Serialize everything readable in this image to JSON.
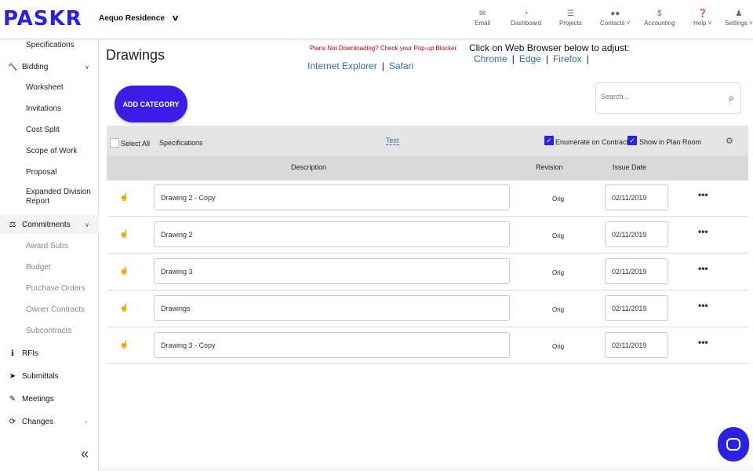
{
  "app": {
    "logo": "PASKR",
    "project": "Aequo Residence"
  },
  "nav": [
    {
      "label": "Email",
      "icon": "email-icon",
      "glyph": "✉"
    },
    {
      "label": "Dashboard",
      "icon": "dashboard-icon",
      "glyph": "◔"
    },
    {
      "label": "Projects",
      "icon": "projects-icon",
      "glyph": "☰"
    },
    {
      "label": "Contacts",
      "icon": "contacts-icon",
      "glyph": "👥"
    },
    {
      "label": "Accounting",
      "icon": "accounting-icon",
      "glyph": "$"
    },
    {
      "label": "Help",
      "icon": "help-icon",
      "glyph": "?"
    },
    {
      "label": "Settings",
      "icon": "settings-icon",
      "glyph": "👤"
    }
  ],
  "sidebar": {
    "top_partial": "Specifications",
    "bidding": {
      "label": "Bidding",
      "items": [
        "Worksheet",
        "Invitations",
        "Cost Split",
        "Scope of Work",
        "Proposal",
        "Expanded Division Report"
      ]
    },
    "commitments": {
      "label": "Commitments",
      "items": [
        "Award Subs",
        "Budget",
        "Purchase Orders",
        "Owner Contracts",
        "Subcontracts"
      ]
    },
    "rfis": "RFIs",
    "submittals": "Submittals",
    "meetings": "Meetings",
    "changes": "Changes"
  },
  "page": {
    "title": "Drawings",
    "notice": "Plans Not Downloading? Check your Pop-up Blocker.",
    "browser_prompt": "Click on Web Browser below to adjust:",
    "browsers": [
      "Chrome",
      "Edge",
      "Firefox",
      "Internet Explorer",
      "Safari"
    ]
  },
  "toolbar": {
    "add_category": "ADD CATEGORY",
    "search_placeholder": "Search...",
    "select_all": "Select All",
    "category": "Specifications",
    "test_link": "Test",
    "enumerate": "Enumerate on Contracts",
    "plan_room": "Show in Plan Room"
  },
  "table": {
    "headers": {
      "description": "Description",
      "revision": "Revision",
      "issue_date": "Issue Date"
    },
    "rows": [
      {
        "description": "Drawing 2 - Copy",
        "revision": "Orig",
        "date": "02/11/2019"
      },
      {
        "description": "Drawing 2",
        "revision": "Orig",
        "date": "02/11/2019"
      },
      {
        "description": "Drawing 3",
        "revision": "Orig",
        "date": "02/11/2019"
      },
      {
        "description": "Drawings",
        "revision": "Orig",
        "date": "02/11/2019"
      },
      {
        "description": "Drawing 3 - Copy",
        "revision": "Orig",
        "date": "02/11/2019"
      }
    ]
  },
  "colors": {
    "brand": "#2a22e0",
    "link": "#2f6fb3",
    "notice": "#cc0000"
  }
}
